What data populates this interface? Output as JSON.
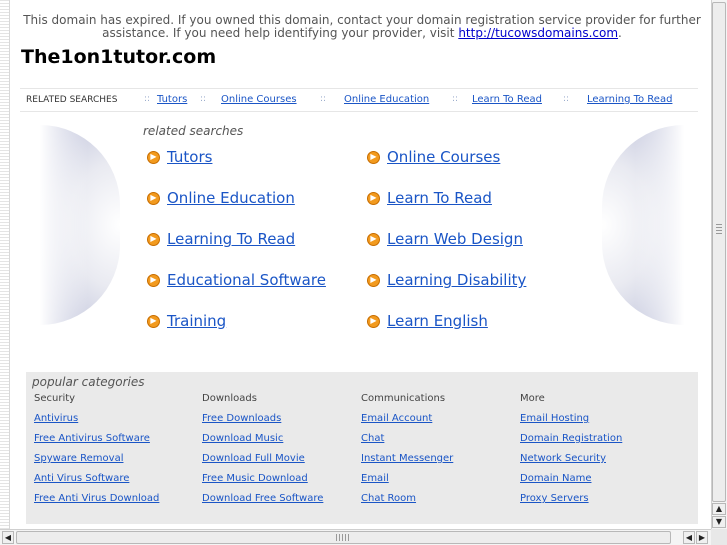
{
  "notice": {
    "text": "This domain has expired. If you owned this domain, contact your domain registration service provider for further assistance. If you need help identifying your provider, visit",
    "link": "http://tucowsdomains.com",
    "end": "."
  },
  "site_title": "The1on1tutor.com",
  "related_bar": {
    "label": "RELATED SEARCHES",
    "separator": "::",
    "links": [
      "Tutors",
      "Online Courses",
      "Online Education",
      "Learn To Read",
      "Learning To Read"
    ]
  },
  "related": {
    "heading": "related searches",
    "left": [
      "Tutors",
      "Online Education",
      "Learning To Read",
      "Educational Software",
      "Training"
    ],
    "right": [
      "Online Courses",
      "Learn To Read",
      "Learn Web Design",
      "Learning Disability",
      "Learn English"
    ]
  },
  "popular": {
    "heading": "popular categories",
    "columns": [
      {
        "title": "Security",
        "links": [
          "Antivirus",
          "Free Antivirus Software",
          "Spyware Removal",
          "Anti Virus Software",
          "Free Anti Virus Download"
        ]
      },
      {
        "title": "Downloads",
        "links": [
          "Free Downloads",
          "Download Music",
          "Download Full Movie",
          "Free Music Download",
          "Download Free Software"
        ]
      },
      {
        "title": "Communications",
        "links": [
          "Email Account",
          "Chat",
          "Instant Messenger",
          "Email",
          "Chat Room"
        ]
      },
      {
        "title": "More",
        "links": [
          "Email Hosting",
          "Domain Registration",
          "Network Security",
          "Domain Name",
          "Proxy Servers"
        ]
      }
    ]
  },
  "icons": {
    "bullet": "arrow-circle-icon",
    "scroll_up": "arrow-up-icon",
    "scroll_down": "arrow-down-icon",
    "scroll_left": "arrow-left-icon",
    "scroll_right": "arrow-right-icon"
  },
  "colors": {
    "link": "#1a55c6",
    "bullet": "#f29a1e",
    "panel": "#eaeaea"
  }
}
